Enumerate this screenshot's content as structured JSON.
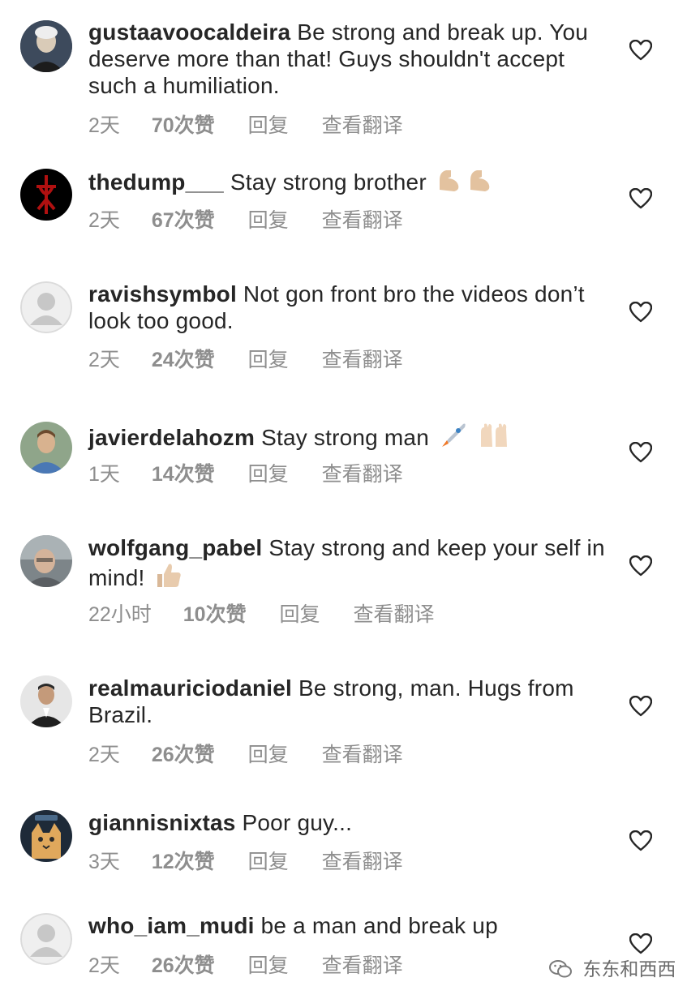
{
  "comments": [
    {
      "username": "gustaavoocaldeira",
      "text": "Be strong and break up. You deserve more than that! Guys shouldn't accept such a humiliation.",
      "time": "2天",
      "likes": "70次赞",
      "reply": "回复",
      "translate": "查看翻译",
      "avatar": "portrait-avatar"
    },
    {
      "username": "thedump___",
      "text": "Stay strong brother",
      "emoji": "flexed-biceps-emoji x2",
      "time": "2天",
      "likes": "67次赞",
      "reply": "回复",
      "translate": "查看翻译",
      "avatar": "red-sigil-avatar"
    },
    {
      "username": "ravishsymbol",
      "text": "Not gon front bro the videos don’t look too good.",
      "time": "2天",
      "likes": "24次赞",
      "reply": "回复",
      "translate": "查看翻译",
      "avatar": "default-avatar"
    },
    {
      "username": "javierdelahozm",
      "text": "Stay strong man",
      "emoji": "rocket-emoji, raising-hands-emoji",
      "time": "1天",
      "likes": "14次赞",
      "reply": "回复",
      "translate": "查看翻译",
      "avatar": "man-portrait-avatar"
    },
    {
      "username": "wolfgang_pabel",
      "text": "Stay strong and keep your self in mind!",
      "emoji": "thumbs-up-emoji",
      "time": "22小时",
      "likes": "10次赞",
      "reply": "回复",
      "translate": "查看翻译",
      "avatar": "man-glasses-avatar"
    },
    {
      "username": "realmauriciodaniel",
      "text": "Be strong, man. Hugs from Brazil.",
      "time": "2天",
      "likes": "26次赞",
      "reply": "回复",
      "translate": "查看翻译",
      "avatar": "man-suit-avatar"
    },
    {
      "username": "giannisnixtas",
      "text": "Poor guy...",
      "time": "3天",
      "likes": "12次赞",
      "reply": "回复",
      "translate": "查看翻译",
      "avatar": "cat-avatar"
    },
    {
      "username": "who_iam_mudi",
      "text": "be a man and break up",
      "time": "2天",
      "likes": "26次赞",
      "reply": "回复",
      "translate": "查看翻译",
      "avatar": "default-avatar"
    }
  ],
  "watermark": {
    "text": "东东和西西",
    "icon": "wechat-icon"
  },
  "colors": {
    "text": "#262626",
    "meta": "#8e8e8e",
    "heart": "#262626",
    "background": "#ffffff"
  }
}
